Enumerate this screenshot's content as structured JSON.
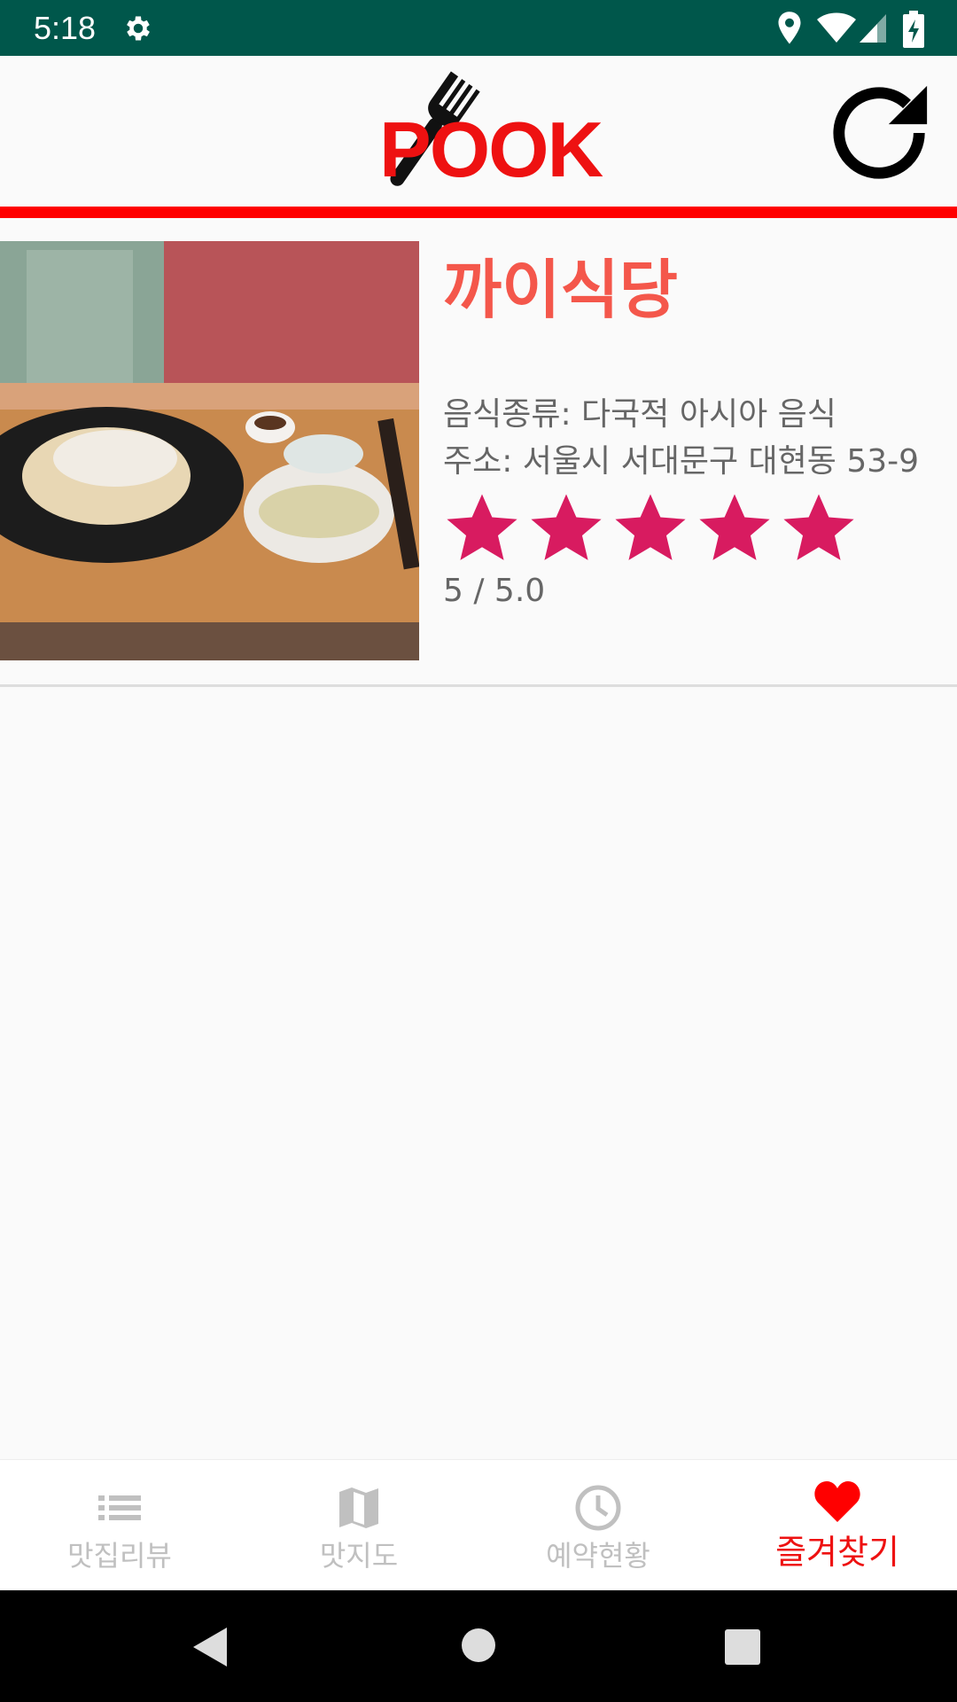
{
  "status_bar": {
    "time": "5:18",
    "icons": [
      "gear-icon",
      "location-icon",
      "wifi-icon",
      "cellular-icon",
      "battery-icon"
    ]
  },
  "header": {
    "logo_text": "POOK",
    "refresh_icon": "refresh-icon"
  },
  "colors": {
    "status_bar": "#00574b",
    "accent_red": "#ff0000",
    "title_coral": "#f4574b",
    "star_pink": "#d81b60",
    "nav_inactive": "#c0c0c0"
  },
  "favorites": [
    {
      "name": "까이식당",
      "food_type": "음식종류: 다국적 아시아 음식",
      "address": "주소: 서울시 서대문구 대현동 53-9",
      "rating": 5,
      "rating_text": "5 / 5.0"
    }
  ],
  "bottom_nav": [
    {
      "label": "맛집리뷰",
      "icon": "list-icon",
      "active": false
    },
    {
      "label": "맛지도",
      "icon": "map-icon",
      "active": false
    },
    {
      "label": "예약현황",
      "icon": "clock-icon",
      "active": false
    },
    {
      "label": "즐겨찾기",
      "icon": "heart-icon",
      "active": true
    }
  ],
  "system_nav": [
    "back-icon",
    "home-icon",
    "recents-icon"
  ]
}
